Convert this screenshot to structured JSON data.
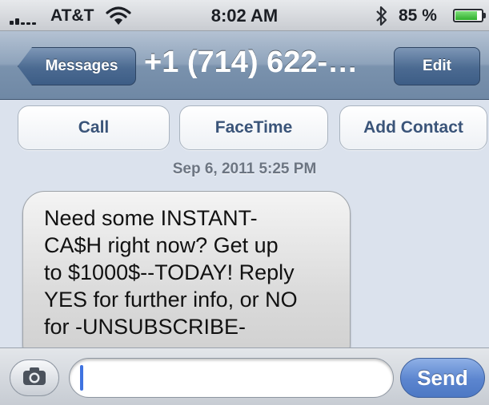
{
  "status_bar": {
    "carrier": "AT&T",
    "time": "8:02 AM",
    "battery_percent": "85 %",
    "battery_level": 0.85,
    "signal_icon": "signal-bars-icon",
    "wifi_icon": "wifi-icon",
    "bluetooth_icon": "bluetooth-icon"
  },
  "nav_bar": {
    "back_label": "Messages",
    "title": "+1 (714) 622-…",
    "edit_label": "Edit"
  },
  "actions": {
    "call_label": "Call",
    "facetime_label": "FaceTime",
    "add_contact_label": "Add Contact"
  },
  "conversation": {
    "timestamp": "Sep 6, 2011 5:25 PM",
    "messages": [
      {
        "direction": "incoming",
        "text": "Need some INSTANT-\nCA$H right now? Get up\nto $1000$--TODAY! Reply\nYES for further info, or NO\nfor -UNSUBSCRIBE-"
      }
    ]
  },
  "composer": {
    "camera_icon": "camera-icon",
    "input_value": "",
    "send_label": "Send"
  },
  "colors": {
    "nav_bar": "#7a92ad",
    "action_text": "#3a5479",
    "send_button": "#5b85cf",
    "cursor": "#3f73e0",
    "battery_fill": "#2fae2b"
  }
}
